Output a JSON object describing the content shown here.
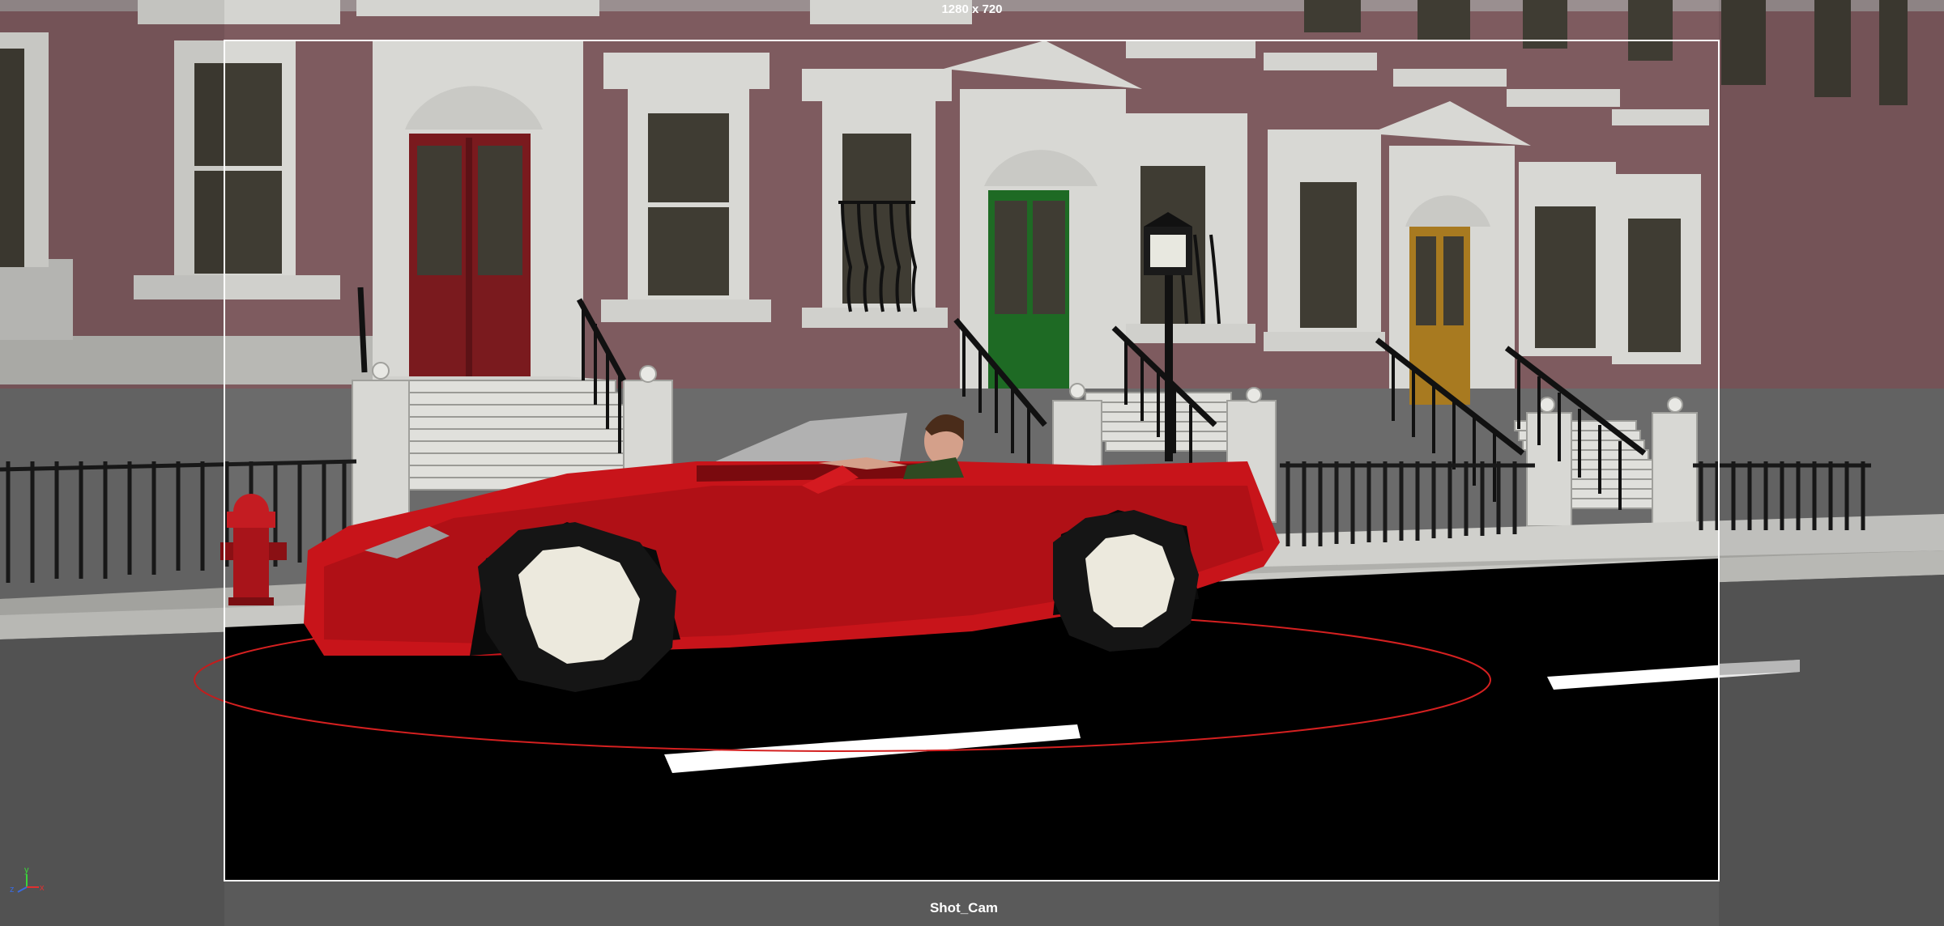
{
  "viewport": {
    "resolution_gate_label": "1280 x 720",
    "camera_name": "Shot_Cam",
    "axis_labels": {
      "x": "x",
      "y": "y",
      "z": "z"
    }
  },
  "colors": {
    "wall": "#7e5b5f",
    "trim": "#d8d8d4",
    "door_red": "#7a1a1e",
    "door_green": "#1e6a24",
    "door_amber": "#a87a20",
    "car_red": "#c8141a",
    "road": "#000000",
    "gate_outline": "#ffffff",
    "selection_circle": "#d42020",
    "outside_gate": "#6b6b6b"
  },
  "scene_objects": {
    "car": "red-convertible",
    "driver": "character",
    "hydrant": "fire-hydrant",
    "lamp": "street-lamp"
  }
}
